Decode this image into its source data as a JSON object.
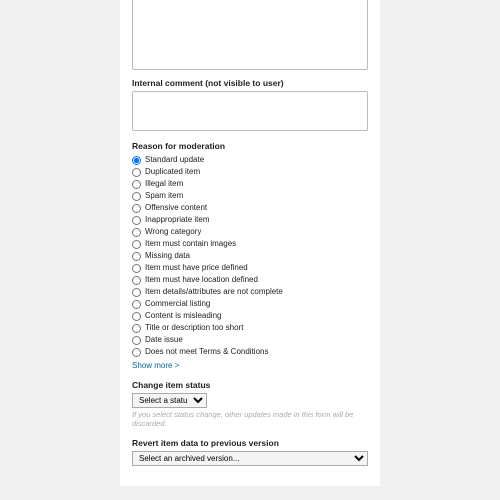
{
  "labels": {
    "internal_comment": "Internal comment (not visible to user)",
    "reason": "Reason for moderation",
    "change_status": "Change item status",
    "revert": "Revert item data to previous version"
  },
  "reasons": [
    "Standard update",
    "Duplicated item",
    "Illegal item",
    "Spam item",
    "Offensive content",
    "Inappropriate item",
    "Wrong category",
    "Item must contain images",
    "Missing data",
    "Item must have price defined",
    "Item must have location defined",
    "Item details/attributes are not complete",
    "Commercial listing",
    "Content is misleading",
    "Title or description too short",
    "Date issue",
    "Does not meet Terms & Conditions"
  ],
  "show_more": "Show more >",
  "status_select": {
    "placeholder": "Select a status..."
  },
  "status_hint": "If you select status change, other updates made in this form will be discarded.",
  "revert_select": {
    "placeholder": "Select an archived version..."
  }
}
